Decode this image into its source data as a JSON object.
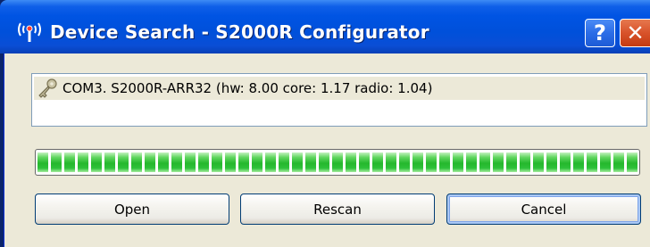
{
  "window": {
    "title": "Device Search - S2000R Configurator",
    "help_label": "?",
    "close_label": "✕"
  },
  "device_list": {
    "items": [
      {
        "label": "COM3. S2000R-ARR32 (hw: 8.00 core: 1.17 radio: 1.04)",
        "icon": "key-icon"
      }
    ]
  },
  "progress": {
    "percent": 100,
    "color": "#2cc13a"
  },
  "buttons": {
    "open": "Open",
    "rescan": "Rescan",
    "cancel": "Cancel"
  },
  "colors": {
    "titlebar": "#0054e3",
    "face": "#ece9d8",
    "selection": "#ece9d8"
  }
}
